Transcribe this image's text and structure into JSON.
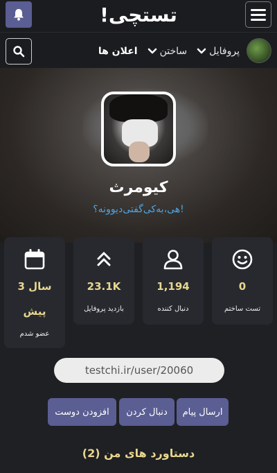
{
  "header": {
    "logo_text": "تستچی!",
    "bell_icon": "bell-icon",
    "menu_icon": "hamburger-menu-icon",
    "colors": {
      "bar_bg": "#1b1c1f",
      "accent": "#5b5e93"
    }
  },
  "navbar": {
    "items": [
      {
        "label": "پروفایل"
      },
      {
        "label": "ساختن"
      },
      {
        "label": "اعلان ها"
      }
    ],
    "search_icon": "search-icon"
  },
  "profile": {
    "name": "کیومرث",
    "bio": "هی،به‌کی‌گفتی‌دیوونه؟!"
  },
  "stats": [
    {
      "icon": "smile-icon",
      "value": "0",
      "label": "تست ساختم"
    },
    {
      "icon": "user-icon",
      "value": "1,194",
      "label": "دنبال کننده"
    },
    {
      "icon": "double-chevron-up-icon",
      "value": "23.1K",
      "label": "بازدید پروفایل"
    },
    {
      "icon": "calendar-icon",
      "value_line1": "3 سال",
      "value_line2": "پیش",
      "label": "عضو شدم"
    }
  ],
  "profile_url": "testchi.ir/user/20060",
  "actions": {
    "message": "ارسال پیام",
    "follow": "دنبال کردن",
    "add_friend": "افزودن دوست"
  },
  "achievements_title": "دستاورد های من (2)"
}
